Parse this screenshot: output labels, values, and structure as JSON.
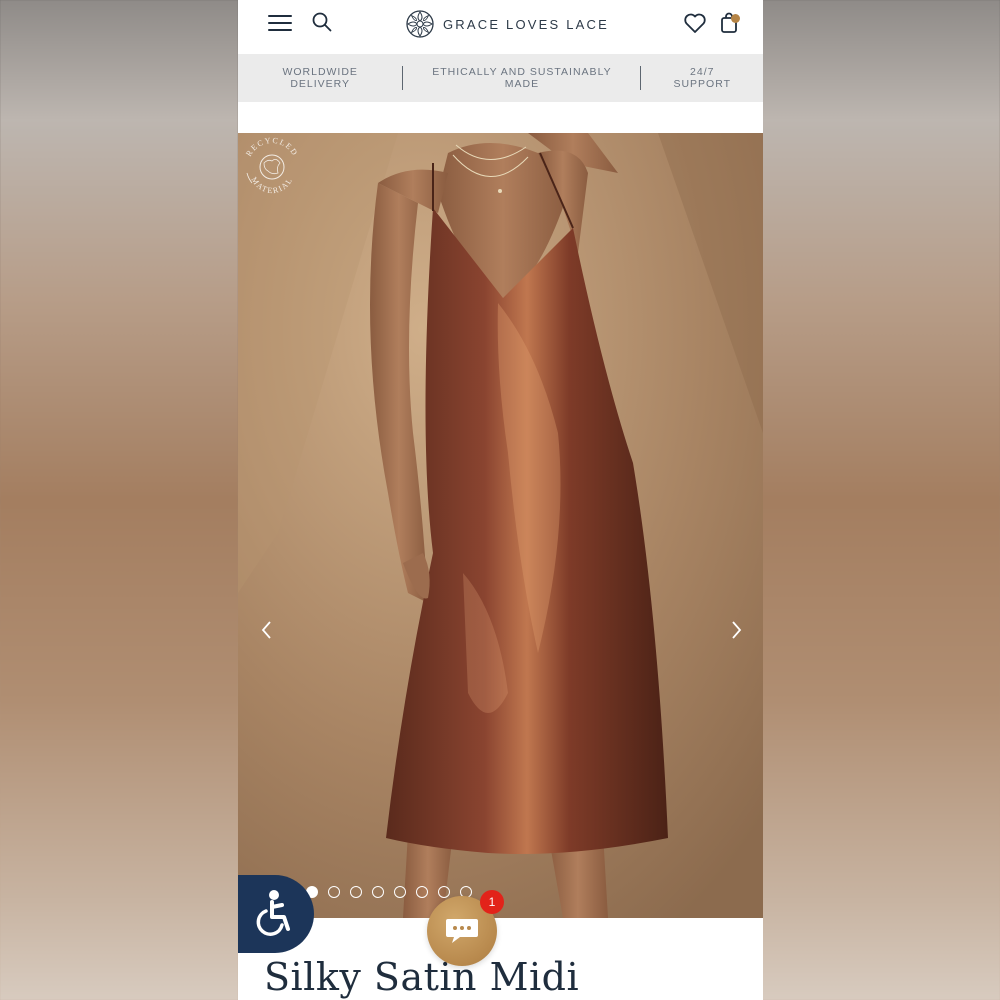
{
  "brand": {
    "name": "GRACE LOVES LACE"
  },
  "header": {
    "menu_icon": "hamburger-icon",
    "search_icon": "search-icon",
    "wishlist_icon": "heart-icon",
    "bag_icon": "shopping-bag-icon"
  },
  "usp": {
    "items": [
      {
        "line1": "WORLDWIDE",
        "line2": "DELIVERY"
      },
      {
        "line1": "ETHICALLY AND SUSTAINABLY",
        "line2": "MADE"
      },
      {
        "line1": "24/7",
        "line2": "SUPPORT"
      }
    ]
  },
  "gallery": {
    "badge": {
      "top": "RECYCLED",
      "bottom": "MATERIAL"
    },
    "slide_count": 8,
    "active_slide": 1
  },
  "chat": {
    "unread": "1"
  },
  "product": {
    "title": "Silky Satin Midi"
  },
  "colors": {
    "navy": "#1c3559",
    "gold": "#b8894d",
    "badge_red": "#e2231a"
  }
}
